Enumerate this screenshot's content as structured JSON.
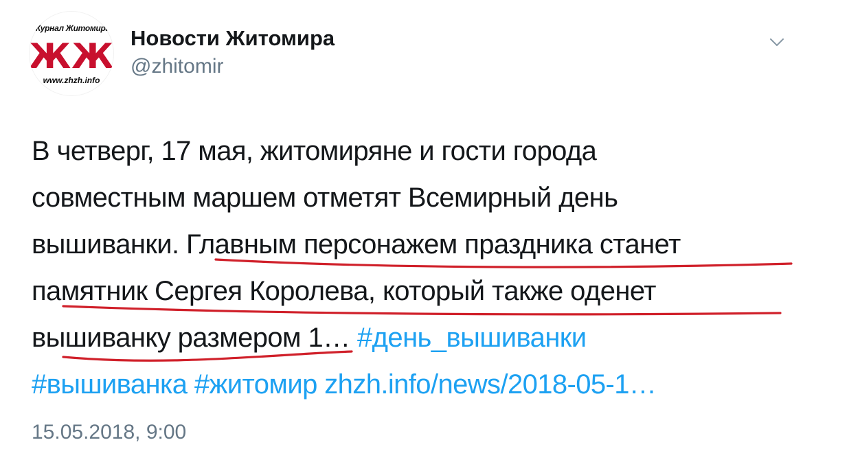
{
  "account": {
    "display_name": "Новости Житомира",
    "handle": "@zhitomir",
    "avatar": {
      "top_text": "Журнал Житомира",
      "mark_text": "ЖЖ",
      "bottom_text": "www.zhzh.info",
      "mark_color": "#c8102e"
    }
  },
  "tweet": {
    "lines": [
      {
        "text": "В четверг, 17 мая, житомиряне и гости города"
      },
      {
        "text": "совместным маршем отметят Всемирный день"
      },
      {
        "text": "вышиванки. Главным персонажем праздника станет"
      },
      {
        "text": "памятник Сергея Королева, который также оденет"
      },
      {
        "text": "вышиванку размером 1… ",
        "link1": "#день_вышиванки"
      },
      {
        "link1": "#вышиванка",
        "link2": "#житомир",
        "link3": "zhzh.info/news/2018-05-1…"
      }
    ],
    "timestamp": "15.05.2018, 9:00"
  },
  "colors": {
    "link": "#1da1f2",
    "text": "#14171a",
    "secondary": "#657786",
    "annotation": "#d0202a"
  },
  "icons": {
    "menu": "chevron-down-icon"
  }
}
